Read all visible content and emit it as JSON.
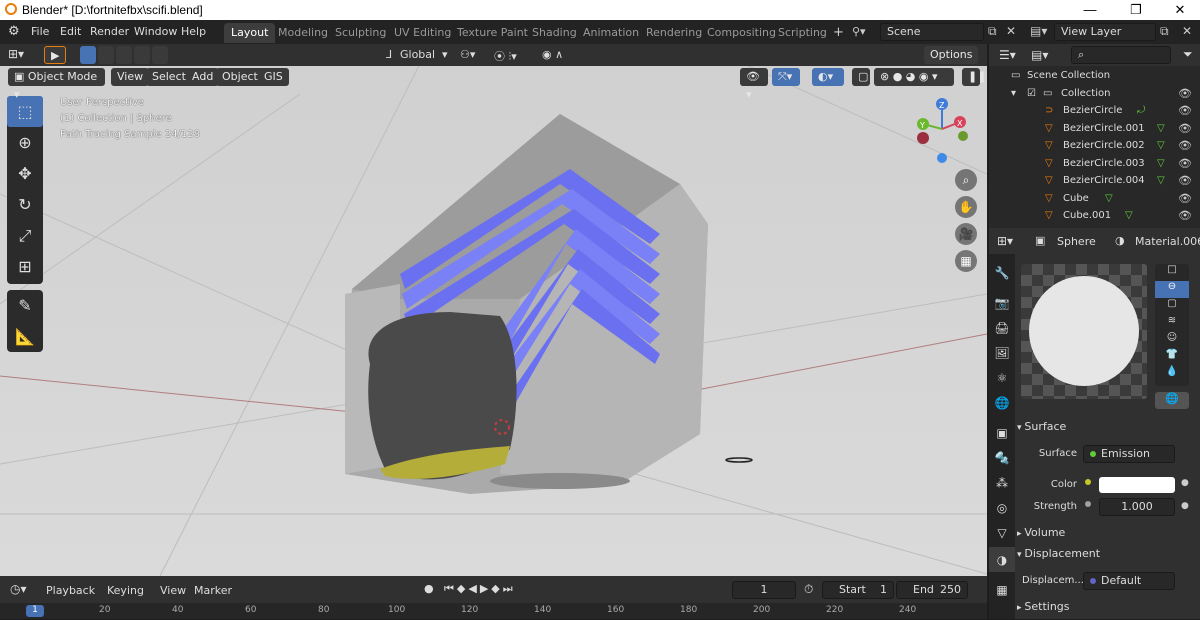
{
  "window": {
    "title": "Blender* [D:\\fortnitefbx\\scifi.blend]",
    "min": "—",
    "max": "❐",
    "close": "✕"
  },
  "menu": [
    "File",
    "Edit",
    "Render",
    "Window",
    "Help"
  ],
  "workspaces": [
    "Layout",
    "Modeling",
    "Sculpting",
    "UV Editing",
    "Texture Paint",
    "Shading",
    "Animation",
    "Rendering",
    "Compositing",
    "Scripting"
  ],
  "add_workspace": "+",
  "scene": {
    "label": "Scene",
    "view_layer": "View Layer"
  },
  "viewport": {
    "transform_orientation": "Global",
    "options": "Options",
    "mode": "Object Mode",
    "menus": [
      "View",
      "Select",
      "Add",
      "Object",
      "GIS"
    ],
    "overlay_lines": [
      "User Perspective",
      "(1) Collection | Sphere",
      "Path Tracing Sample 24/128"
    ],
    "gizmo": {
      "z": "Z",
      "y": "Y",
      "x": "X"
    }
  },
  "timeline": {
    "menus": [
      "Playback",
      "Keying",
      "View",
      "Marker"
    ],
    "current_frame": "1",
    "start_label": "Start",
    "start": "1",
    "end_label": "End",
    "end": "250",
    "ruler": [
      "1",
      "20",
      "40",
      "60",
      "80",
      "100",
      "120",
      "140",
      "160",
      "180",
      "200",
      "220",
      "240"
    ]
  },
  "outliner": {
    "search_placeholder": "",
    "scene_collection": "Scene Collection",
    "collection": "Collection",
    "items": [
      {
        "name": "BezierCircle"
      },
      {
        "name": "BezierCircle.001"
      },
      {
        "name": "BezierCircle.002"
      },
      {
        "name": "BezierCircle.003"
      },
      {
        "name": "BezierCircle.004"
      },
      {
        "name": "Cube"
      },
      {
        "name": "Cube.001"
      }
    ]
  },
  "properties": {
    "object": "Sphere",
    "material": "Material.006",
    "surface_section": "Surface",
    "surface_label": "Surface",
    "surface_value": "Emission",
    "color_label": "Color",
    "color_value": "#ffffff",
    "strength_label": "Strength",
    "strength_value": "1.000",
    "volume_section": "Volume",
    "displacement_section": "Displacement",
    "displacement_label": "Displacem...",
    "displacement_value": "Default",
    "settings_section": "Settings"
  },
  "colors": {
    "accent": "#4772b3",
    "orange": "#e87d0d",
    "mesh_icon": "#e87d0d",
    "data_icon": "#5fcc3a"
  }
}
